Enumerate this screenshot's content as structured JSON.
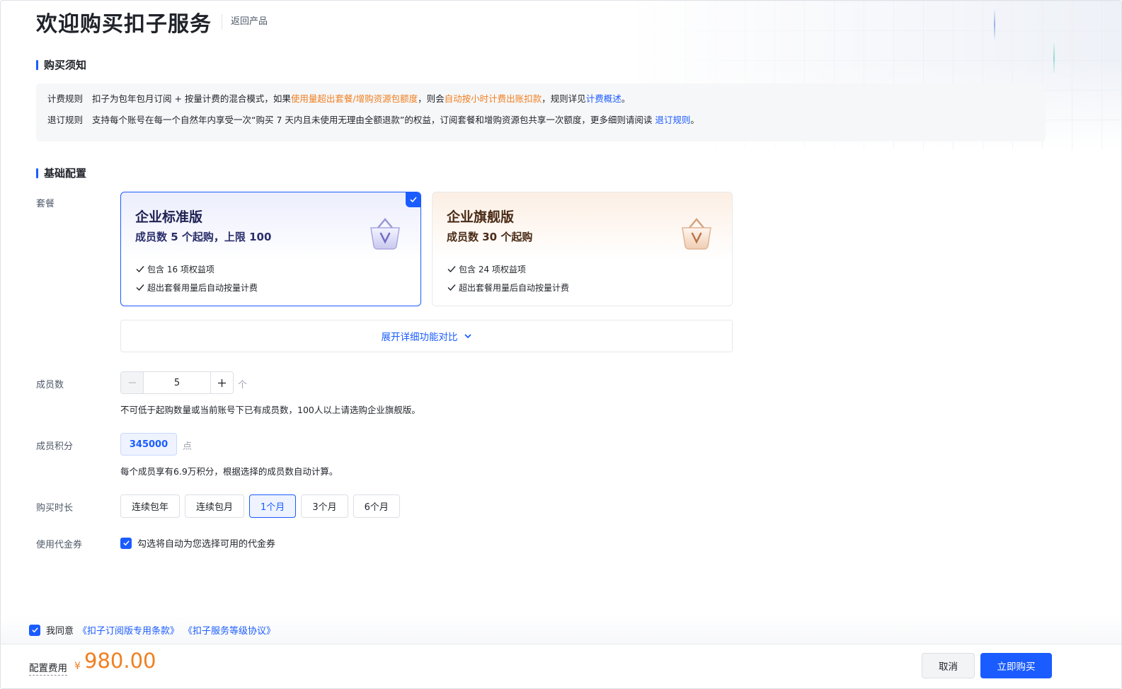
{
  "header": {
    "title": "欢迎购买扣子服务",
    "back_link": "返回产品"
  },
  "notice": {
    "section_title": "购买须知",
    "billing": {
      "label": "计费规则",
      "text_1": "扣子为包年包月订阅 + 按量计费的混合模式，如果",
      "highlight_1": "使用量超出套餐/增购资源包额度",
      "text_2": "，则会",
      "highlight_2": "自动按小时计费出账扣款",
      "text_3": "，规则详见",
      "link": "计费概述",
      "text_4": "。"
    },
    "refund": {
      "label": "退订规则",
      "text_1": "支持每个账号在每一个自然年内享受一次“购买 7 天内且未使用无理由全额退款”的权益，订阅套餐和增购资源包共享一次额度，更多细则请阅读 ",
      "link": "退订规则",
      "text_2": "。"
    }
  },
  "config": {
    "section_title": "基础配置",
    "plan_label": "套餐",
    "plans": [
      {
        "name": "企业标准版",
        "subtitle": "成员数 5 个起购，上限 100",
        "features": [
          "包含 16 项权益项",
          "超出套餐用量后自动按量计费"
        ],
        "selected": true
      },
      {
        "name": "企业旗舰版",
        "subtitle": "成员数 30 个起购",
        "features": [
          "包含 24 项权益项",
          "超出套餐用量后自动按量计费"
        ],
        "selected": false
      }
    ],
    "expand_label": "展开详细功能对比",
    "members": {
      "label": "成员数",
      "value": "5",
      "unit": "个",
      "hint": "不可低于起购数量或当前账号下已有成员数，100人以上请选购企业旗舰版。"
    },
    "points": {
      "label": "成员积分",
      "value": "345000",
      "unit": "点",
      "hint": "每个成员享有6.9万积分，根据选择的成员数自动计算。"
    },
    "duration": {
      "label": "购买时长",
      "options": [
        "连续包年",
        "连续包月",
        "1个月",
        "3个月",
        "6个月"
      ],
      "selected": "1个月"
    },
    "coupon": {
      "label": "使用代金券",
      "text": "勾选将自动为您选择可用的代金券",
      "checked": true
    }
  },
  "agreement": {
    "prefix": "我同意",
    "link_1": "《扣子订阅版专用条款》",
    "link_2": "《扣子服务等级协议》",
    "checked": true
  },
  "footer": {
    "fee_label": "配置费用",
    "currency": "¥",
    "amount": "980.00",
    "cancel_label": "取消",
    "buy_label": "立即购买"
  },
  "colors": {
    "accent": "#1a5cff",
    "highlight": "#f07f20"
  }
}
